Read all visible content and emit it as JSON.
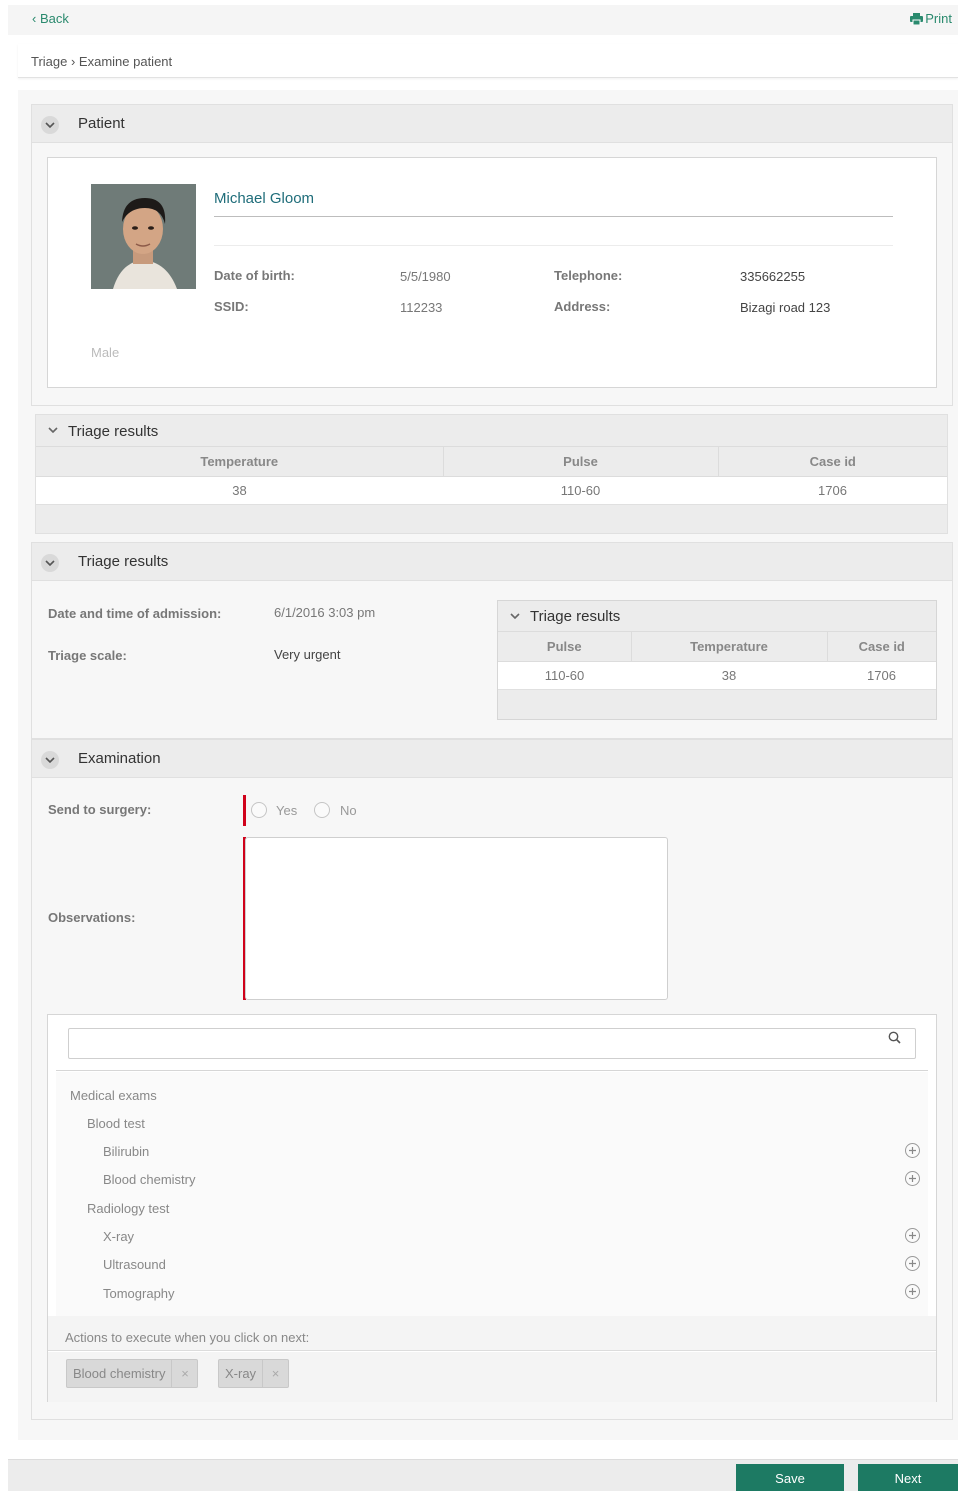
{
  "topbar": {
    "back_label": "Back",
    "print_label": "Print"
  },
  "breadcrumb": {
    "text": "Triage › Examine patient"
  },
  "patient_panel": {
    "title": "Patient",
    "name": "Michael Gloom",
    "dob_label": "Date of birth:",
    "dob_value": "5/5/1980",
    "telephone_label": "Telephone:",
    "telephone_value": "335662255",
    "ssid_label": "SSID:",
    "ssid_value": "112233",
    "address_label": "Address:",
    "address_value": "Bizagi road 123",
    "gender": "Male"
  },
  "triage_grid_1": {
    "title": "Triage results",
    "columns": [
      "Temperature",
      "Pulse",
      "Case id"
    ],
    "rows": [
      [
        "38",
        "110-60",
        "1706"
      ]
    ]
  },
  "triage_panel": {
    "title": "Triage results",
    "admission_label": "Date and time of admission:",
    "admission_value": "6/1/2016 3:03 pm",
    "scale_label": "Triage scale:",
    "scale_value": "Very urgent",
    "grid": {
      "title": "Triage results",
      "columns": [
        "Pulse",
        "Temperature",
        "Case id"
      ],
      "rows": [
        [
          "110-60",
          "38",
          "1706"
        ]
      ]
    }
  },
  "examination_panel": {
    "title": "Examination",
    "surgery_label": "Send to surgery:",
    "yes_label": "Yes",
    "no_label": "No",
    "observations_label": "Observations:",
    "tree": {
      "root": "Medical exams",
      "group1": "Blood test",
      "g1_items": [
        "Bilirubin",
        "Blood chemistry"
      ],
      "group2": "Radiology test",
      "g2_items": [
        "X-ray",
        "Ultrasound",
        "Tomography"
      ]
    },
    "actions_label": "Actions to execute when you click on next:",
    "chips": [
      "Blood chemistry",
      "X-ray"
    ],
    "chip_remove": "×"
  },
  "footer": {
    "save_label": "Save",
    "next_label": "Next"
  },
  "colors": {
    "accent": "#1d7a63",
    "link": "#2a8a6e",
    "required": "#d0021b",
    "name": "#1f6d7a"
  }
}
